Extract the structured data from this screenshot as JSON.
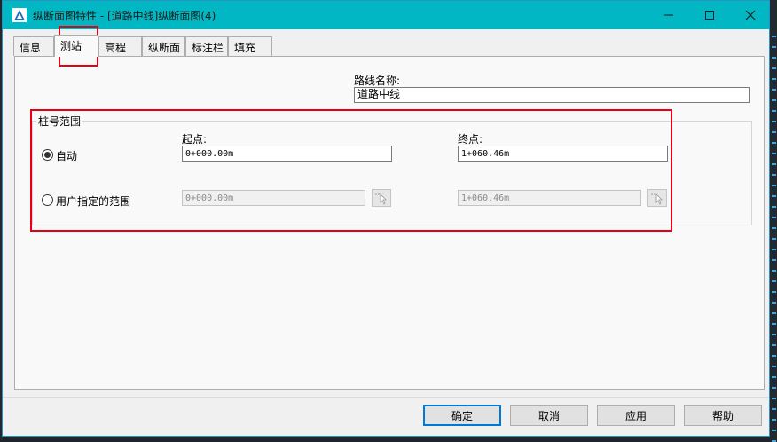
{
  "window": {
    "title": "纵断面图特性 - [道路中线]纵断面图(4)"
  },
  "tabs": [
    {
      "label": "信息"
    },
    {
      "label": "测站"
    },
    {
      "label": "高程"
    },
    {
      "label": "纵断面"
    },
    {
      "label": "标注栏"
    },
    {
      "label": "填充"
    }
  ],
  "active_tab": "测站",
  "alignment": {
    "label": "路线名称:",
    "value": "道路中线"
  },
  "station_range": {
    "group_label": "桩号范围",
    "start_label": "起点:",
    "end_label": "终点:",
    "auto": {
      "label": "自动",
      "selected": true,
      "start_value": "0+000.00m",
      "end_value": "1+060.46m"
    },
    "user": {
      "label": "用户指定的范围",
      "selected": false,
      "start_value": "0+000.00m",
      "end_value": "1+060.46m"
    }
  },
  "buttons": {
    "ok": "确定",
    "cancel": "取消",
    "apply": "应用",
    "help": "帮助"
  },
  "colors": {
    "titlebar": "#00b7c3",
    "highlight": "#e60012",
    "default_button_border": "#0078d7"
  }
}
